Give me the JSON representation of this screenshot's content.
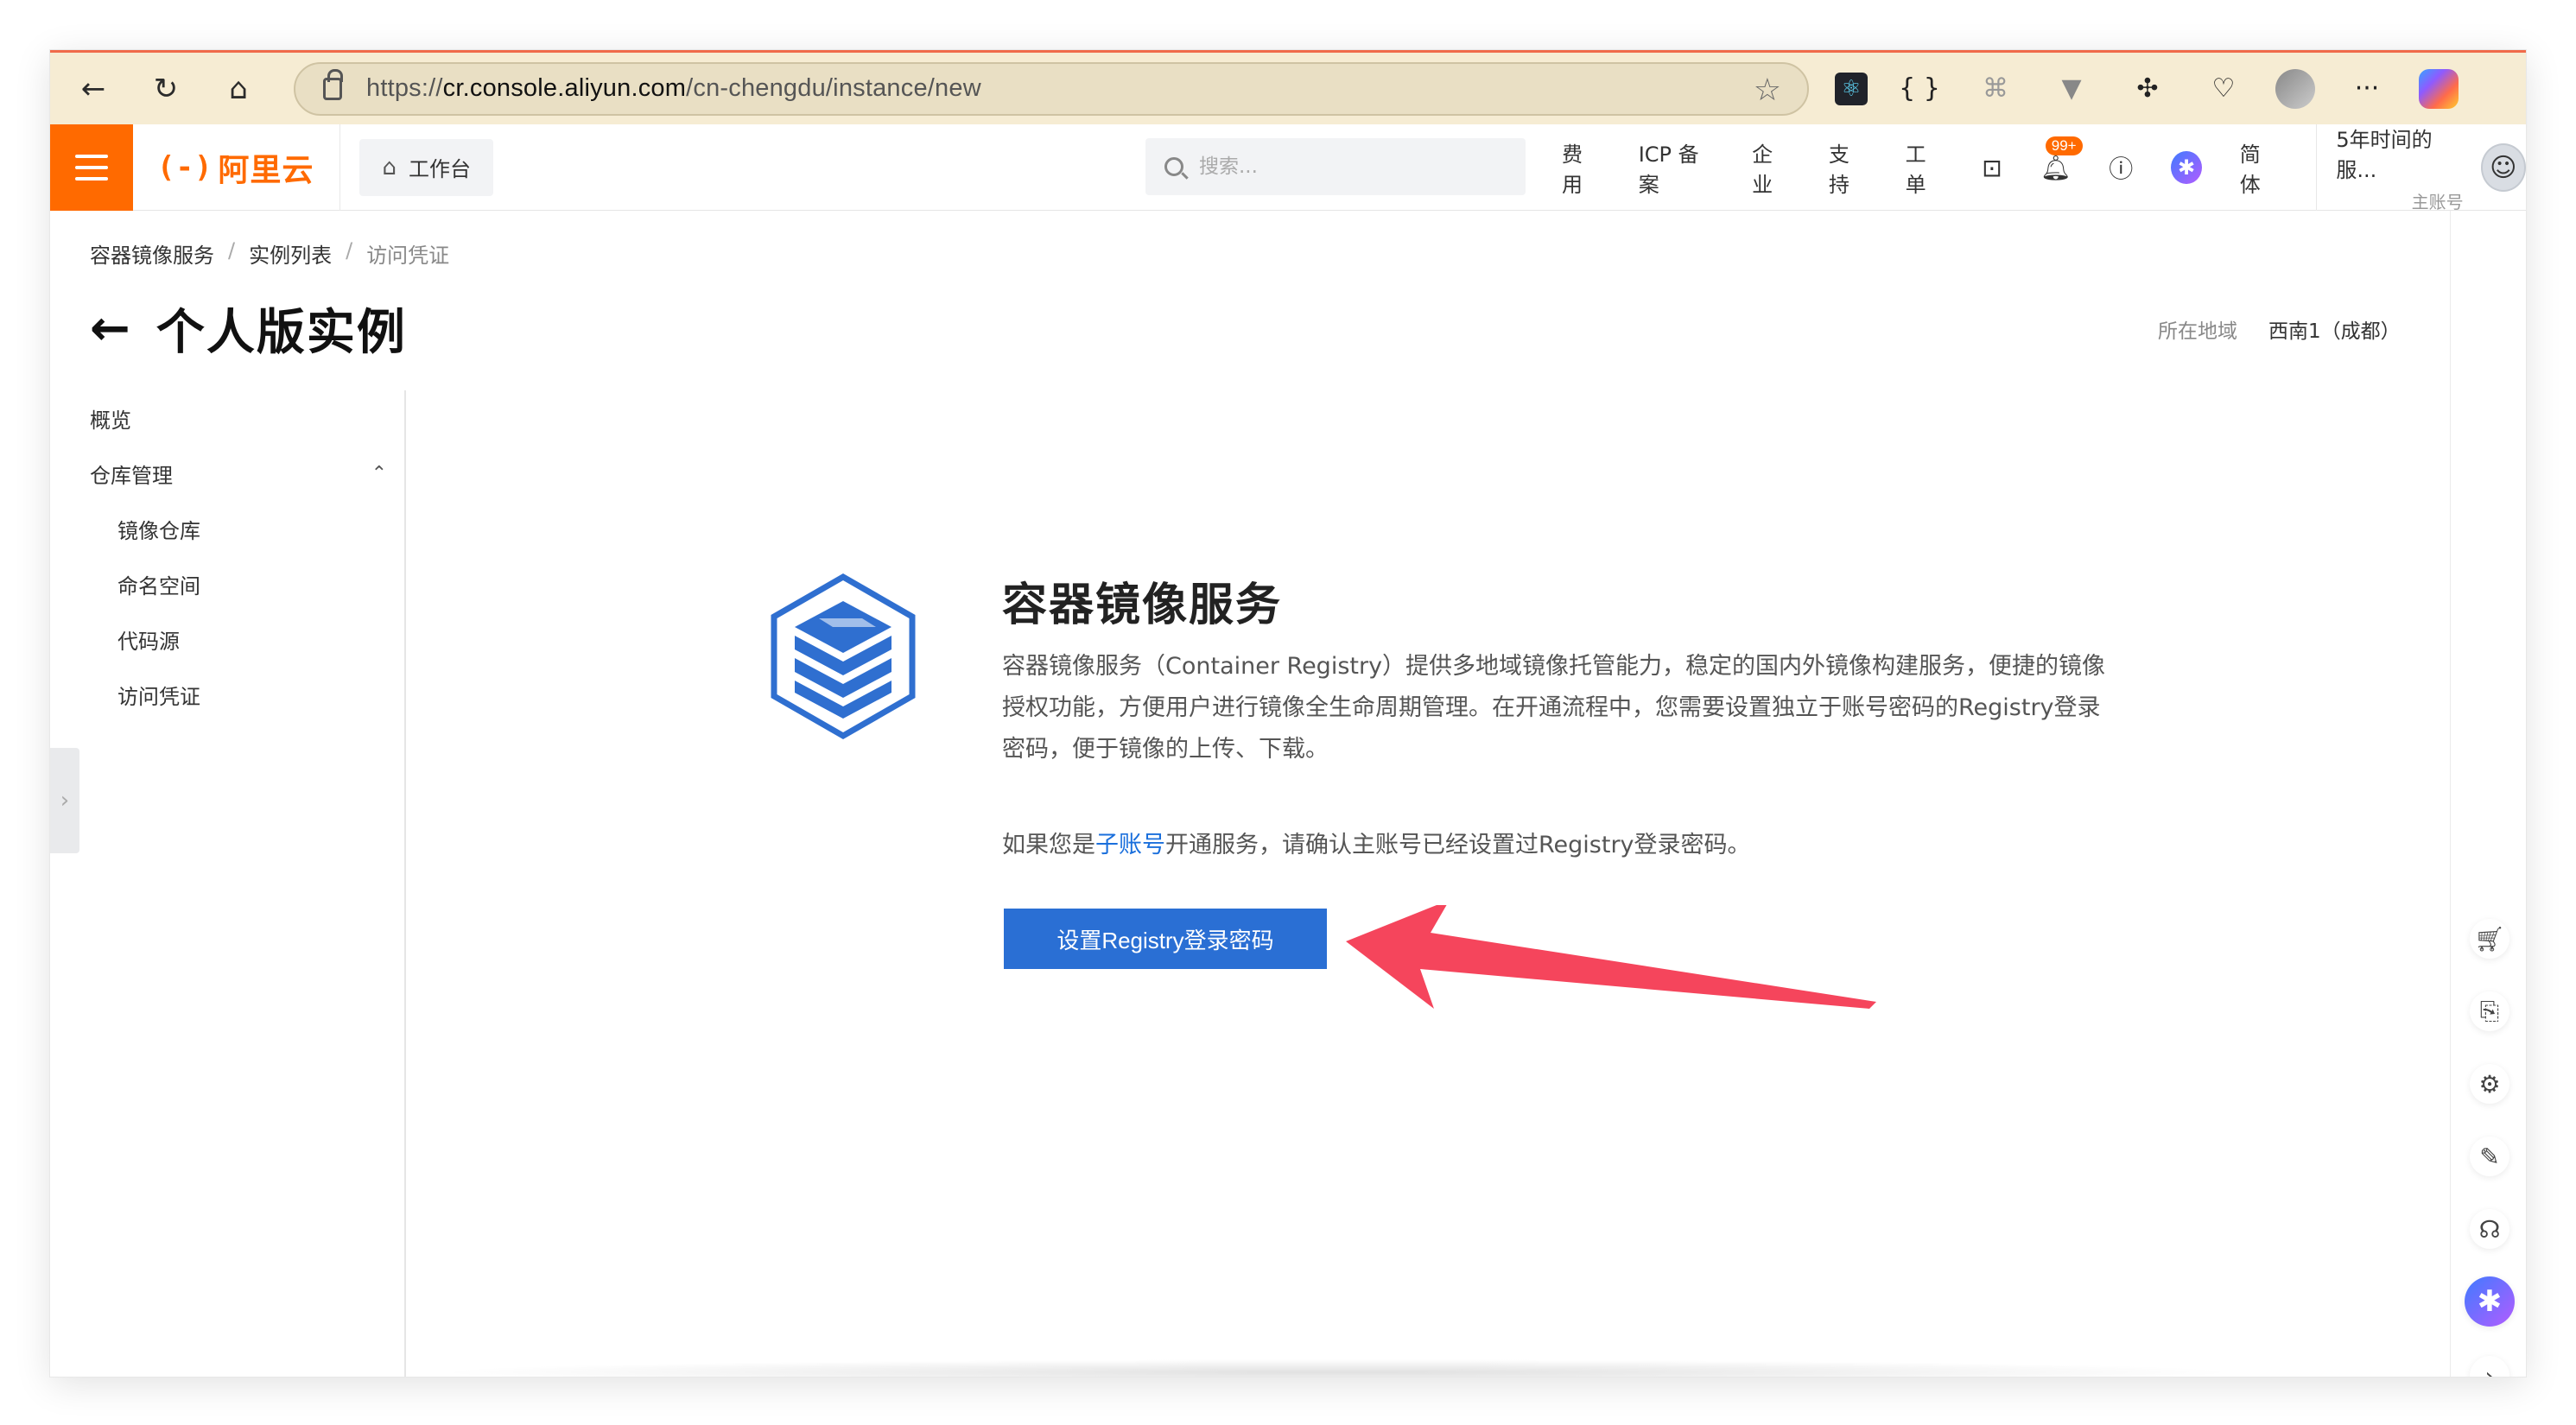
{
  "browser": {
    "url_prefix": "https://",
    "url_host": "cr.console.aliyun.com",
    "url_path": "/cn-chengdu/instance/new",
    "back_glyph": "←",
    "reload_glyph": "↻",
    "home_glyph": "⌂",
    "star_glyph": "☆",
    "extensions": [
      {
        "name": "react-devtools-icon",
        "glyph": "⚛"
      },
      {
        "name": "json-viewer-icon",
        "glyph": "{ }"
      },
      {
        "name": "command-icon",
        "glyph": "⌘"
      },
      {
        "name": "vue-devtools-icon",
        "glyph": "▼"
      },
      {
        "name": "puzzle-extensions-icon",
        "glyph": "✣"
      },
      {
        "name": "health-icon",
        "glyph": "♡"
      },
      {
        "name": "profile-avatar-icon",
        "glyph": ""
      },
      {
        "name": "more-menu-icon",
        "glyph": "···"
      },
      {
        "name": "copilot-icon",
        "glyph": ""
      }
    ]
  },
  "topnav": {
    "logo_mark": "(-)",
    "logo_text": "阿里云",
    "workbench_label": "工作台",
    "search_placeholder": "搜索...",
    "links": [
      "费用",
      "ICP 备案",
      "企业",
      "支持",
      "工单"
    ],
    "notification_badge": "99+",
    "language": "简体",
    "account_name": "5年时间的服...",
    "account_type": "主账号"
  },
  "breadcrumb": [
    "容器镜像服务",
    "实例列表",
    "访问凭证"
  ],
  "page": {
    "title": "个人版实例",
    "region_label": "所在地域",
    "region_value": "西南1（成都）"
  },
  "sidebar": {
    "overview": "概览",
    "repo_group": "仓库管理",
    "items": [
      "镜像仓库",
      "命名空间",
      "代码源",
      "访问凭证"
    ]
  },
  "main": {
    "service_title": "容器镜像服务",
    "description": "容器镜像服务（Container Registry）提供多地域镜像托管能力，稳定的国内外镜像构建服务，便捷的镜像授权功能，方便用户进行镜像全生命周期管理。在开通流程中，您需要设置独立于账号密码的Registry登录密码，便于镜像的上传、下载。",
    "note_prefix": "如果您是",
    "note_link": "子账号",
    "note_suffix": "开通服务，请确认主账号已经设置过Registry登录密码。",
    "primary_button": "设置Registry登录密码"
  },
  "colors": {
    "brand_orange": "#ff6a00",
    "primary_blue": "#2a6fd4",
    "annotation_arrow": "#f5455c"
  }
}
